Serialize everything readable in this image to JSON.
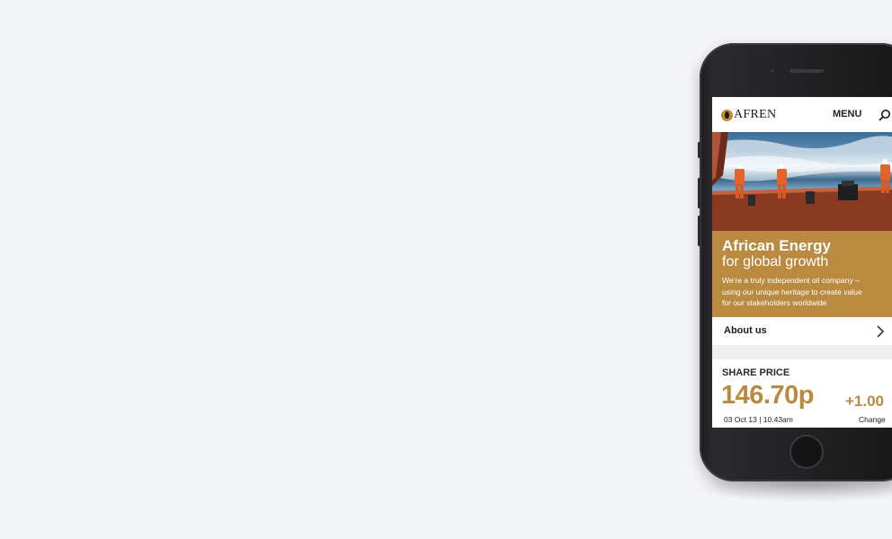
{
  "brand": {
    "name": "AFREN"
  },
  "nav": {
    "menu_label": "MENU",
    "search_icon": "search-icon"
  },
  "promo": {
    "title": "African Energy",
    "subtitle": "for global growth",
    "description": "We're a truly independent oil company – using our unique heritage to create value for our stakeholders worldwide"
  },
  "about": {
    "label": "About us",
    "icon": "chevron-right-icon"
  },
  "share_price": {
    "title": "SHARE PRICE",
    "price": "146.70p",
    "date": "03 Oct 13 | 10.43am",
    "change_value": "+1.00",
    "change_label": "Change"
  },
  "colors": {
    "accent": "#b98a40",
    "background": "#f4f5f9",
    "phone_body": "#1c1c1e"
  }
}
